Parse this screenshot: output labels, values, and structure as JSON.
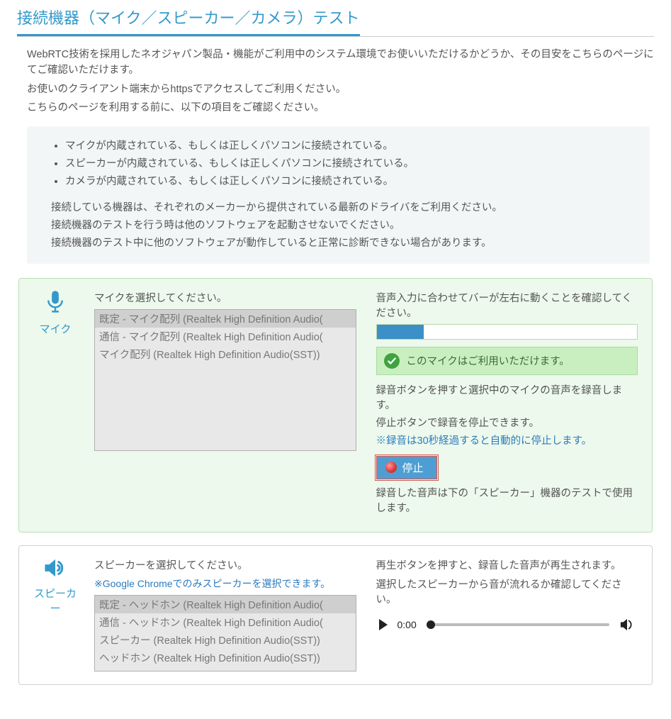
{
  "page_title": "接続機器（マイク／スピーカー／カメラ）テスト",
  "intro": {
    "p1": "WebRTC技術を採用したネオジャパン製品・機能がご利用中のシステム環境でお使いいただけるかどうか、その目安をこちらのページにてご確認いただけます。",
    "p2": "お使いのクライアント端末からhttpsでアクセスしてご利用ください。",
    "p3": "こちらのページを利用する前に、以下の項目をご確認ください。"
  },
  "note_box": {
    "bullets": [
      "マイクが内蔵されている、もしくは正しくパソコンに接続されている。",
      "スピーカーが内蔵されている、もしくは正しくパソコンに接続されている。",
      "カメラが内蔵されている、もしくは正しくパソコンに接続されている。"
    ],
    "lines": [
      "接続している機器は、それぞれのメーカーから提供されている最新のドライバをご利用ください。",
      "接続機器のテストを行う時は他のソフトウェアを起動させないでください。",
      "接続機器のテスト中に他のソフトウェアが動作していると正常に診断できない場合があります。"
    ]
  },
  "mic": {
    "side_label": "マイク",
    "select_label": "マイクを選択してください。",
    "options": [
      "既定 - マイク配列 (Realtek High Definition Audio(",
      "通信 - マイク配列 (Realtek High Definition Audio(",
      "マイク配列 (Realtek High Definition Audio(SST))"
    ],
    "level_label": "音声入力に合わせてバーが左右に動くことを確認してください。",
    "status_ok": "このマイクはご利用いただけます。",
    "rec_line1": "録音ボタンを押すと選択中のマイクの音声を録音します。",
    "rec_line2": "停止ボタンで録音を停止できます。",
    "rec_note": "※録音は30秒経過すると自動的に停止します。",
    "stop_label": "停止",
    "after_rec": "録音した音声は下の「スピーカー」機器のテストで使用します。"
  },
  "speaker": {
    "side_label": "スピーカー",
    "select_label": "スピーカーを選択してください。",
    "chrome_note": "※Google Chromeでのみスピーカーを選択できます。",
    "options": [
      "既定 - ヘッドホン (Realtek High Definition Audio(",
      "通信 - ヘッドホン (Realtek High Definition Audio(",
      "スピーカー (Realtek High Definition Audio(SST))",
      "ヘッドホン (Realtek High Definition Audio(SST))"
    ],
    "play_line1": "再生ボタンを押すと、録音した音声が再生されます。",
    "play_line2": "選択したスピーカーから音が流れるか確認してください。",
    "time_text": "0:00"
  }
}
